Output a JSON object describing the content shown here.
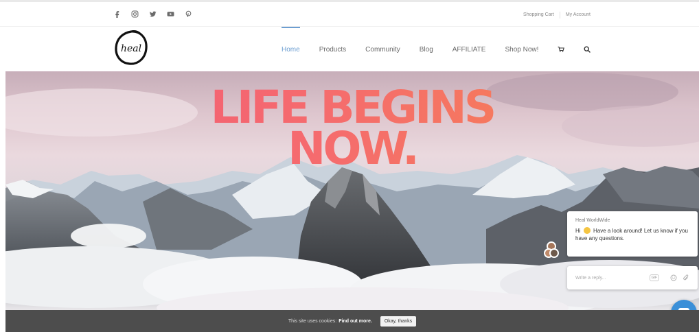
{
  "topbar": {
    "social_icons": [
      "facebook-icon",
      "instagram-icon",
      "twitter-icon",
      "youtube-icon",
      "pinterest-icon"
    ],
    "links": [
      "Shopping Cart",
      "My Account"
    ]
  },
  "header": {
    "logo_text": "heal",
    "nav": [
      {
        "label": "Home",
        "active": true
      },
      {
        "label": "Products"
      },
      {
        "label": "Community"
      },
      {
        "label": "Blog"
      },
      {
        "label": "AFFILIATE"
      },
      {
        "label": "Shop Now!"
      }
    ],
    "nav_icons": [
      "cart-icon",
      "search-icon"
    ],
    "accent": "#6c9ed1"
  },
  "hero": {
    "line1": "LIFE BEGINS",
    "line2": "NOW.",
    "gradient_from": "#f35777",
    "gradient_to": "#f6874d"
  },
  "chat": {
    "from": "Heal WorldWide",
    "greeting": "Hi",
    "message": "Have a look around! Let us know if you have any questions.",
    "reply_placeholder": "Write a reply...",
    "gif_label": "GIF",
    "launcher_color": "#3a8fd8"
  },
  "cookie": {
    "text": "This site uses cookies:",
    "link": "Find out more.",
    "button": "Okay, thanks"
  }
}
